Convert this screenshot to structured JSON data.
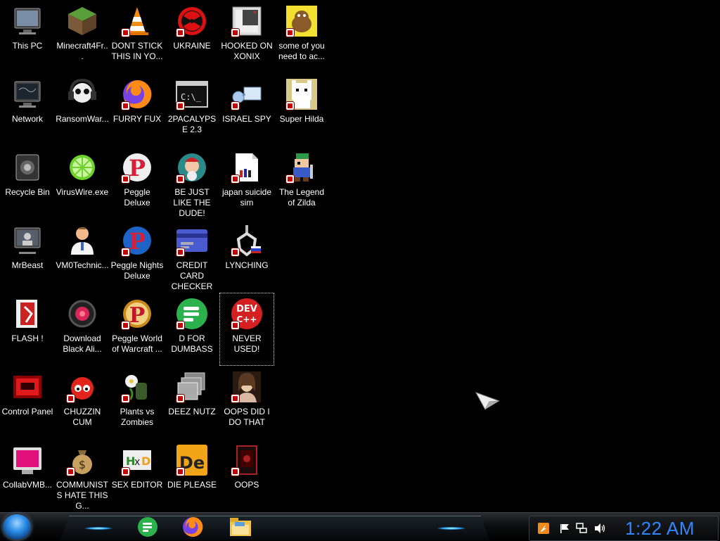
{
  "desktop": {
    "background_color": "#000000",
    "selected_icon": "NEVER USED!",
    "columns": [
      [
        {
          "label": "This PC",
          "icon": "computer-icon"
        },
        {
          "label": "Network",
          "icon": "network-icon"
        },
        {
          "label": "Recycle Bin",
          "icon": "recycle-bin-icon"
        },
        {
          "label": "MrBeast",
          "icon": "user-monitor-icon"
        },
        {
          "label": "FLASH !",
          "icon": "flash-icon"
        },
        {
          "label": "Control Panel",
          "icon": "control-panel-icon"
        },
        {
          "label": "CollabVMB...",
          "icon": "collabvm-icon"
        }
      ],
      [
        {
          "label": "Minecraft4Fr...",
          "icon": "minecraft-grass-block-icon"
        },
        {
          "label": "RansomWar...",
          "icon": "skull-headphones-icon"
        },
        {
          "label": "VirusWire.exe",
          "icon": "limewire-icon"
        },
        {
          "label": "VM0Technic...",
          "icon": "doctor-icon"
        },
        {
          "label": "Download Black Ali...",
          "icon": "black-alien-icon"
        },
        {
          "label": "CHUZZIN CUM",
          "icon": "chuzzle-icon"
        },
        {
          "label": "COMMUNISTS HATE THIS G...",
          "icon": "money-bag-icon"
        }
      ],
      [
        {
          "label": "DONT STICK THIS IN YO...",
          "icon": "vlc-cone-icon"
        },
        {
          "label": "FURRY FUX",
          "icon": "firefox-icon"
        },
        {
          "label": "Peggle Deluxe",
          "icon": "peggle-icon"
        },
        {
          "label": "Peggle Nights Deluxe",
          "icon": "peggle-nights-icon"
        },
        {
          "label": "Peggle World of Warcraft ...",
          "icon": "peggle-wow-icon"
        },
        {
          "label": "Plants vs Zombies",
          "icon": "plants-vs-zombies-icon"
        },
        {
          "label": "SEX EDITOR",
          "icon": "hxd-icon"
        }
      ],
      [
        {
          "label": "UKRAINE",
          "icon": "radiation-icon"
        },
        {
          "label": "2PACALYPSE 2.3",
          "icon": "terminal-icon"
        },
        {
          "label": "BE JUST LIKE THE DUDE!",
          "icon": "bowling-icon"
        },
        {
          "label": "CREDIT CARD CHECKER",
          "icon": "credit-card-icon"
        },
        {
          "label": "D FOR DUMBASS",
          "icon": "feedly-icon"
        },
        {
          "label": "DEEZ NUTZ",
          "icon": "stacked-windows-icon"
        },
        {
          "label": "DIE PLEASE",
          "icon": "de-icon"
        }
      ],
      [
        {
          "label": "HOOKED ON XONIX",
          "icon": "xonix-icon"
        },
        {
          "label": "ISRAEL SPY",
          "icon": "network-spy-icon"
        },
        {
          "label": "japan suicide sim",
          "icon": "document-icon"
        },
        {
          "label": "LYNCHING",
          "icon": "noose-icon"
        },
        {
          "label": "NEVER USED!",
          "icon": "devcpp-icon"
        },
        {
          "label": "OOPS DID I DO THAT",
          "icon": "portrait-icon"
        },
        {
          "label": "OOPS",
          "icon": "dark-app-icon"
        }
      ],
      [
        {
          "label": "some of you need to ac...",
          "icon": "dog-icon"
        },
        {
          "label": "Super Hilda",
          "icon": "pixel-cat-icon"
        },
        {
          "label": "The Legend of Zilda",
          "icon": "pixel-hero-icon"
        }
      ]
    ]
  },
  "taskbar": {
    "start_button": "start-orb-icon",
    "pinned_apps": [
      {
        "name": "feedly-icon"
      },
      {
        "name": "firefox-icon"
      },
      {
        "name": "file-explorer-icon"
      }
    ],
    "tray_icons": [
      "security-shield-icon",
      "flag-icon",
      "network-tray-icon",
      "volume-icon"
    ],
    "clock": "1:22 AM",
    "clock_color": "#2f86ff"
  }
}
